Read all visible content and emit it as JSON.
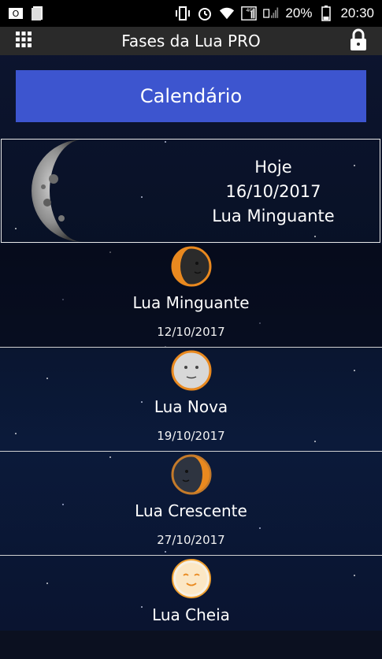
{
  "status_bar": {
    "battery": "20%",
    "time": "20:30",
    "network": "4G"
  },
  "app_bar": {
    "title": "Fases da Lua PRO"
  },
  "calendar_button": {
    "label": "Calendário"
  },
  "today": {
    "label": "Hoje",
    "date": "16/10/2017",
    "phase": "Lua Minguante"
  },
  "phases": [
    {
      "name": "Lua Minguante",
      "date": "12/10/2017",
      "icon": "waning-moon-icon"
    },
    {
      "name": "Lua Nova",
      "date": "19/10/2017",
      "icon": "new-moon-icon"
    },
    {
      "name": "Lua Crescente",
      "date": "27/10/2017",
      "icon": "waxing-moon-icon"
    },
    {
      "name": "Lua Cheia",
      "date": "",
      "icon": "full-moon-icon"
    }
  ],
  "colors": {
    "accent": "#3d55cf",
    "moon_orange": "#e9891f"
  }
}
